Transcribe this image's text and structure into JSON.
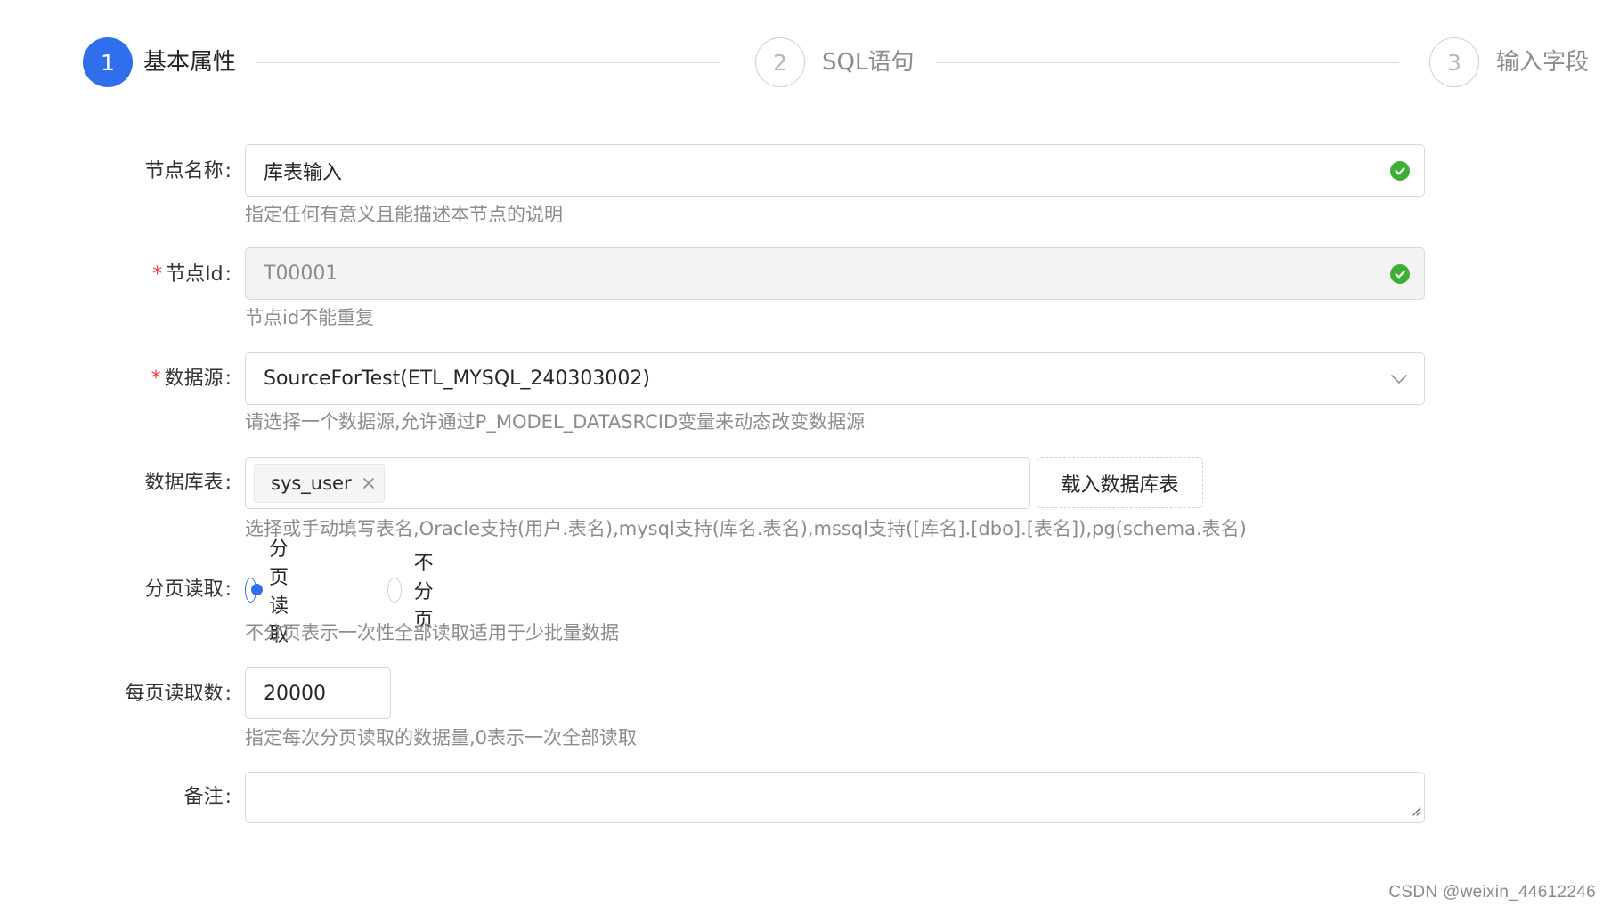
{
  "steps": [
    {
      "number": "1",
      "title": "基本属性",
      "state": "active"
    },
    {
      "number": "2",
      "title": "SQL语句",
      "state": "wait"
    },
    {
      "number": "3",
      "title": "输入字段",
      "state": "wait"
    }
  ],
  "form": {
    "node_name": {
      "label": "节点名称",
      "value": "库表输入",
      "help": "指定任何有意义且能描述本节点的说明",
      "status_icon": "check-circle-icon"
    },
    "node_id": {
      "label": "节点Id",
      "required_mark": "*",
      "value": "T00001",
      "help": "节点id不能重复",
      "status_icon": "check-circle-icon"
    },
    "datasource": {
      "label": "数据源",
      "required_mark": "*",
      "value": "SourceForTest(ETL_MYSQL_240303002)",
      "help": "请选择一个数据源,允许通过P_MODEL_DATASRCID变量来动态改变数据源",
      "dropdown_icon": "chevron-down-icon"
    },
    "db_table": {
      "label": "数据库表",
      "tags": [
        "sys_user"
      ],
      "load_button": "载入数据库表",
      "help": "选择或手动填写表名,Oracle支持(用户.表名),mysql支持(库名.表名),mssql支持([库名].[dbo].[表名]),pg(schema.表名)"
    },
    "paging": {
      "label": "分页读取",
      "options": [
        "分页读取",
        "不分页"
      ],
      "selected": "分页读取",
      "help": "不分页表示一次性全部读取适用于少批量数据"
    },
    "page_size": {
      "label": "每页读取数",
      "value": "20000",
      "help": "指定每次分页读取的数据量,0表示一次全部读取"
    },
    "remark": {
      "label": "备注",
      "value": ""
    }
  },
  "colors": {
    "primary": "#2f6fec",
    "success": "#3cb034",
    "required": "#e8423c",
    "help_text": "#8c8c8c"
  },
  "watermark": "CSDN @weixin_44612246"
}
